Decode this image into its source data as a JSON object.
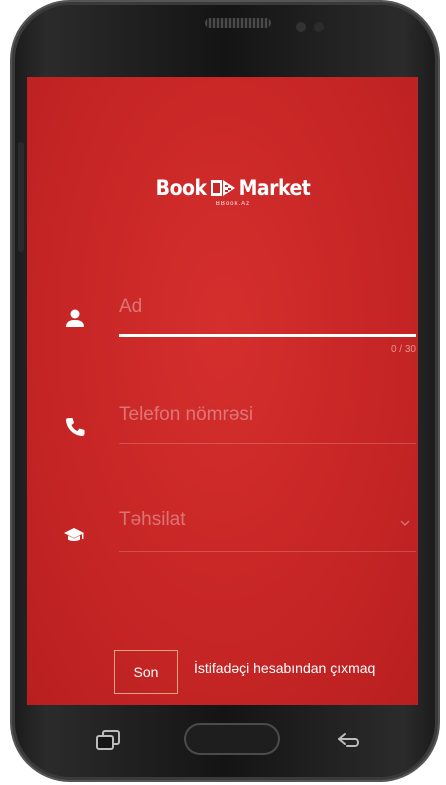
{
  "app": {
    "logo_text_left": "Book",
    "logo_text_right": "Market",
    "logo_subtitle": "BBook.Az",
    "brand_color": "#c62828"
  },
  "form": {
    "name": {
      "placeholder": "Ad",
      "value": "",
      "counter": "0 / 30",
      "icon": "person-icon"
    },
    "phone": {
      "placeholder": "Telefon nömrəsi",
      "value": "",
      "icon": "phone-icon"
    },
    "education": {
      "selected_label": "Təhsilat",
      "icon": "graduation-cap-icon"
    }
  },
  "actions": {
    "submit_label": "Son",
    "logout_label": "İstifadəçi hesabından çıxmaq"
  },
  "navbar": {
    "recent_icon": "recent-apps-icon",
    "home_icon": "home-button",
    "back_icon": "back-arrow-icon"
  }
}
